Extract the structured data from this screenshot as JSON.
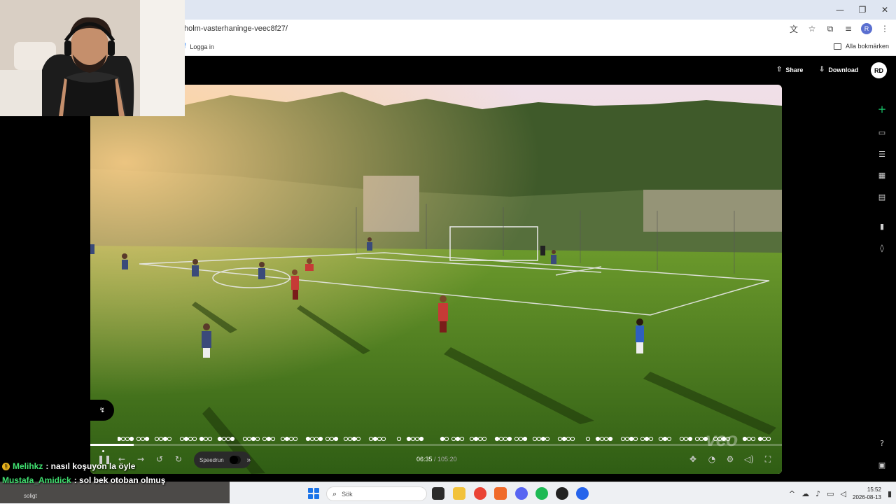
{
  "browser": {
    "url": "holm-vasterhaninge-veec8f27/",
    "bookmarks": {
      "login": "Logga in",
      "all_bookmarks": "Alla bokmärken"
    },
    "profile_initial": "R",
    "window_controls": {
      "minimize": "—",
      "restore": "❐",
      "close": "✕"
    }
  },
  "veo": {
    "share_label": "Share",
    "download_label": "Download",
    "avatar_initials": "RD",
    "rail_icons": [
      "plus-icon",
      "video-icon",
      "list-icon",
      "grid-icon",
      "document-icon",
      "stats-icon",
      "shirt-icon",
      "help-icon",
      "panel-icon"
    ],
    "player": {
      "current_time": "06:35",
      "separator": " / ",
      "duration": "105:20",
      "progress": 0.0625,
      "speedrun_label": "Speedrun",
      "watermark": "veo"
    }
  },
  "chat": [
    {
      "user": "Melihkz",
      "message": " : nasıl koşuyon la öyle",
      "has_badge": true
    },
    {
      "user": "Mustafa_Amidick",
      "message": " : sol bek otoban olmuş",
      "has_badge": false
    }
  ],
  "chat_strip_text": "soligt",
  "taskbar": {
    "search_placeholder": "Sök",
    "time": "15:52",
    "date": "2026-08-13"
  },
  "colors": {
    "accent_green": "#19c46a",
    "windows_blue": "#1a73e8"
  }
}
